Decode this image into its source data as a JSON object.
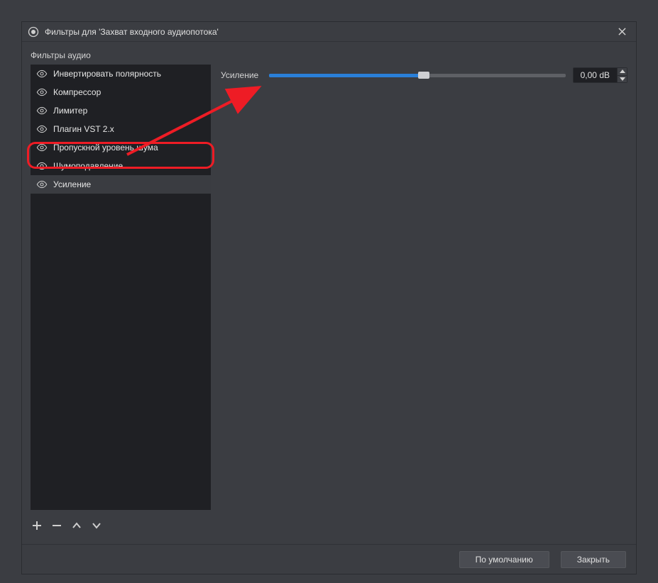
{
  "window": {
    "title": "Фильтры для 'Захват входного аудиопотока'"
  },
  "sidebar": {
    "label": "Фильтры аудио",
    "items": [
      {
        "label": "Инвертировать полярность"
      },
      {
        "label": "Компрессор"
      },
      {
        "label": "Лимитер"
      },
      {
        "label": "Плагин VST 2.x"
      },
      {
        "label": "Пропускной уровень шума"
      },
      {
        "label": "Шумоподавление"
      },
      {
        "label": "Усиление"
      }
    ],
    "selected_index": 6
  },
  "settings": {
    "gain": {
      "label": "Усиление",
      "value_display": "0,00 dB",
      "value_db": 0.0,
      "min_db": -30.0,
      "max_db": 30.0,
      "slider_percent": 52.3
    }
  },
  "footer": {
    "defaults_label": "По умолчанию",
    "close_label": "Закрыть"
  },
  "annotation": {
    "highlight_filter": "Усиление",
    "arrow_points_to": "gain-slider"
  }
}
